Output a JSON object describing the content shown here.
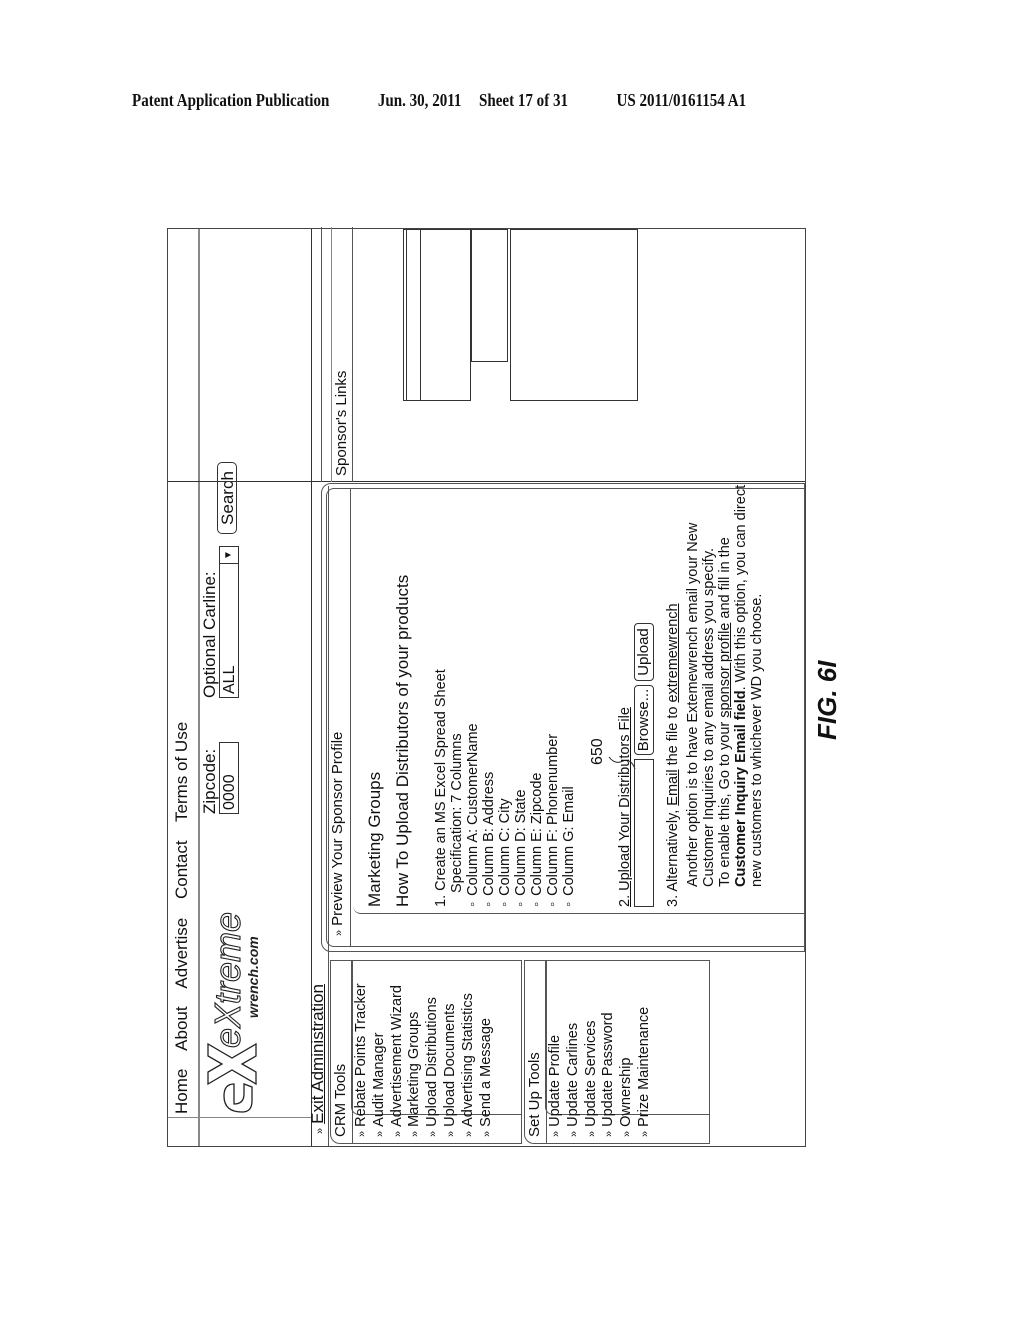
{
  "header": {
    "publication": "Patent Application Publication",
    "date": "Jun. 30, 2011",
    "sheet": "Sheet 17 of 31",
    "number": "US 2011/0161154 A1"
  },
  "site": {
    "logo_text": "eXtreme",
    "logo_subtext": "wrench.com",
    "nav": [
      "Home",
      "About",
      "Advertise",
      "Contact",
      "Terms of Use"
    ]
  },
  "search": {
    "zipcode_label": "Zipcode:",
    "zipcode_value": "0000",
    "carline_label": "Optional Carline:",
    "carline_value": "ALL",
    "search_button": "Search"
  },
  "exit_admin": "Exit Administration",
  "sidebar": {
    "crm": {
      "title": "CRM Tools",
      "items": [
        "Rebate Points Tracker",
        "Audit Manager",
        "Advertisement Wizard",
        "Marketing Groups",
        "Upload Distributions",
        "Upload Documents",
        "Advertising Statistics",
        "Send a Message"
      ]
    },
    "setup": {
      "title": "Set Up Tools",
      "items": [
        "Update Profile",
        "Update Carlines",
        "Update Services",
        "Update Password",
        "Ownership",
        "Prize Maintenance"
      ]
    }
  },
  "main": {
    "header_link": "Preview Your Sponsor Profile",
    "title": "Marketing Groups",
    "subtitle": "How To Upload Distributors of your products",
    "step1": {
      "line1": "1. Create an MS Excel Spread Sheet",
      "line2": "Specification: 7 Columns",
      "columns": [
        "Column A: CustomerName",
        "Column B: Address",
        "Column C: City",
        "Column D: State",
        "Column E: Zipcode",
        "Column F: Phonenumber",
        "Column G: Email"
      ]
    },
    "step2": {
      "label": "2. Upload Your Distributors File",
      "file_value": "",
      "browse_button": "Browse...",
      "upload_button": "Upload",
      "reference_numeral": "650"
    },
    "step3": {
      "prefix": "3. Alternatively, ",
      "email_link": "Email",
      "middle": " the file to ",
      "target_link": "extremewrench",
      "para1": "Another option is to have Extemewrench email your New Customer Inquiries to any email address you specify.",
      "para2_a": "To enable this, Go to your ",
      "para2_link": "sponsor profile",
      "para2_b": " and fill in the ",
      "para2_bold": "Customer Inquiry Email field",
      "para2_c": ". With this option, you can direct new customers to whichever WD you choose."
    }
  },
  "sponsor": {
    "title": "Sponsor's Links"
  },
  "figure_label": "FIG. 6I",
  "icons": {
    "chevron": "»",
    "dropdown_arrow": "▼"
  }
}
